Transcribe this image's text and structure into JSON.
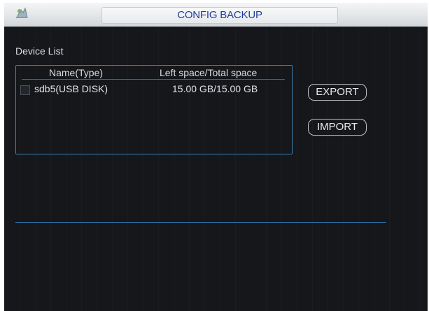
{
  "window": {
    "title": "CONFIG BACKUP",
    "icon": "config-icon"
  },
  "device_list": {
    "label": "Device List",
    "columns": [
      "Name(Type)",
      "Left space/Total space"
    ],
    "rows": [
      {
        "name": "sdb5(USB DISK)",
        "space": "15.00 GB/15.00 GB",
        "checked": false
      }
    ]
  },
  "buttons": {
    "export": "EXPORT",
    "import": "IMPORT"
  },
  "colors": {
    "title_text": "#1d3f9a",
    "panel_bg": "#15171b",
    "border_accent": "#3f7fb0"
  }
}
